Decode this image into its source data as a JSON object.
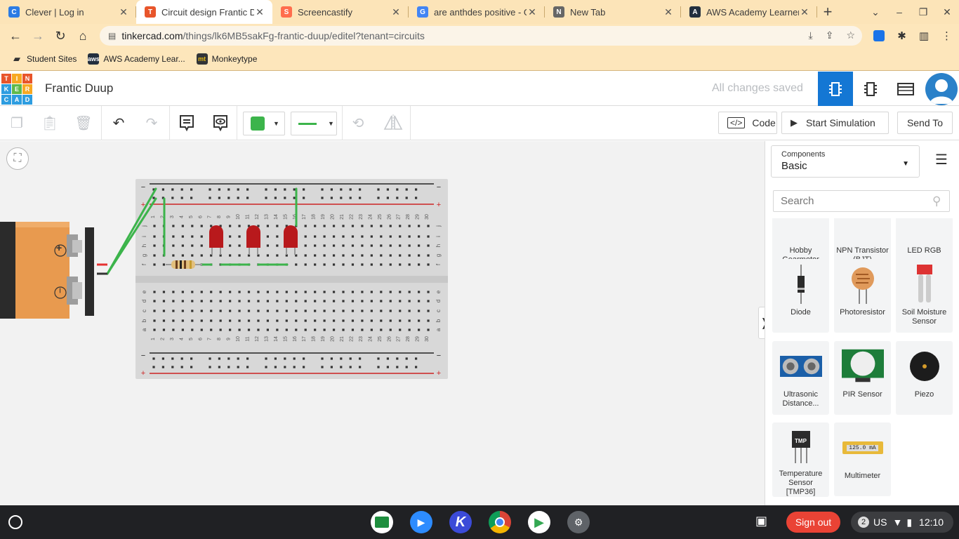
{
  "tabs": [
    {
      "title": "Clever | Log in",
      "favicon": "C",
      "favicon_color": "#2b7be4",
      "active": false
    },
    {
      "title": "Circuit design Frantic D",
      "favicon": "T",
      "favicon_color": "#e8552b",
      "active": true
    },
    {
      "title": "Screencastify",
      "favicon": "S",
      "favicon_color": "#ff6d4d",
      "active": false
    },
    {
      "title": "are anthdes positive - G",
      "favicon": "G",
      "favicon_color": "#4285f4",
      "active": false
    },
    {
      "title": "New Tab",
      "favicon": "N",
      "favicon_color": "#666666",
      "active": false
    },
    {
      "title": "AWS Academy Learner",
      "favicon": "A",
      "favicon_color": "#232f3e",
      "active": false
    }
  ],
  "address": {
    "site": "tinkercad.com",
    "path": "/things/lk6MB5sakFg-frantic-duup/editel?tenant=circuits"
  },
  "bookmarks": [
    {
      "label": "Student Sites",
      "icon": "folder-icon"
    },
    {
      "label": "AWS Academy Lear...",
      "icon": "aws-icon"
    },
    {
      "label": "Monkeytype",
      "icon": "monkeytype-icon"
    }
  ],
  "tinkercad": {
    "logo_letters": [
      "T",
      "I",
      "N",
      "K",
      "E",
      "R",
      "C",
      "A",
      "D"
    ],
    "project_title": "Frantic Duup",
    "save_status": "All changes saved"
  },
  "editor_toolbar": {
    "code_label": "Code",
    "simulation_label": "Start Simulation",
    "send_label": "Send To",
    "wire_color": "#3cb44b"
  },
  "panel": {
    "components_label": "Components",
    "components_value": "Basic",
    "search_placeholder": "Search",
    "cards": [
      {
        "name": "Hobby Gearmotor"
      },
      {
        "name": "NPN Transistor (BJT)"
      },
      {
        "name": "LED RGB"
      },
      {
        "name": "Diode"
      },
      {
        "name": "Photoresistor"
      },
      {
        "name": "Soil Moisture Sensor"
      },
      {
        "name": "Ultrasonic Distance..."
      },
      {
        "name": "PIR Sensor"
      },
      {
        "name": "Piezo"
      },
      {
        "name": "Temperature Sensor [TMP36]"
      },
      {
        "name": "Multimeter"
      }
    ],
    "multimeter_readout": "125.0 mA",
    "tmp_label": "TMP"
  },
  "breadboard": {
    "column_numbers": [
      "1",
      "2",
      "3",
      "4",
      "5",
      "6",
      "7",
      "8",
      "9",
      "10",
      "11",
      "12",
      "13",
      "14",
      "15",
      "16",
      "17",
      "18",
      "19",
      "20",
      "21",
      "22",
      "23",
      "24",
      "25",
      "26",
      "27",
      "28",
      "29",
      "30"
    ],
    "top_rows": [
      "j",
      "i",
      "h",
      "g",
      "f"
    ],
    "bottom_rows": [
      "e",
      "d",
      "c",
      "b",
      "a"
    ],
    "minus": "−",
    "plus": "+"
  },
  "battery": {
    "plus": "+",
    "minus": "−"
  },
  "shelf": {
    "sign_out": "Sign out",
    "notif_count": "2",
    "locale": "US",
    "time": "12:10"
  }
}
